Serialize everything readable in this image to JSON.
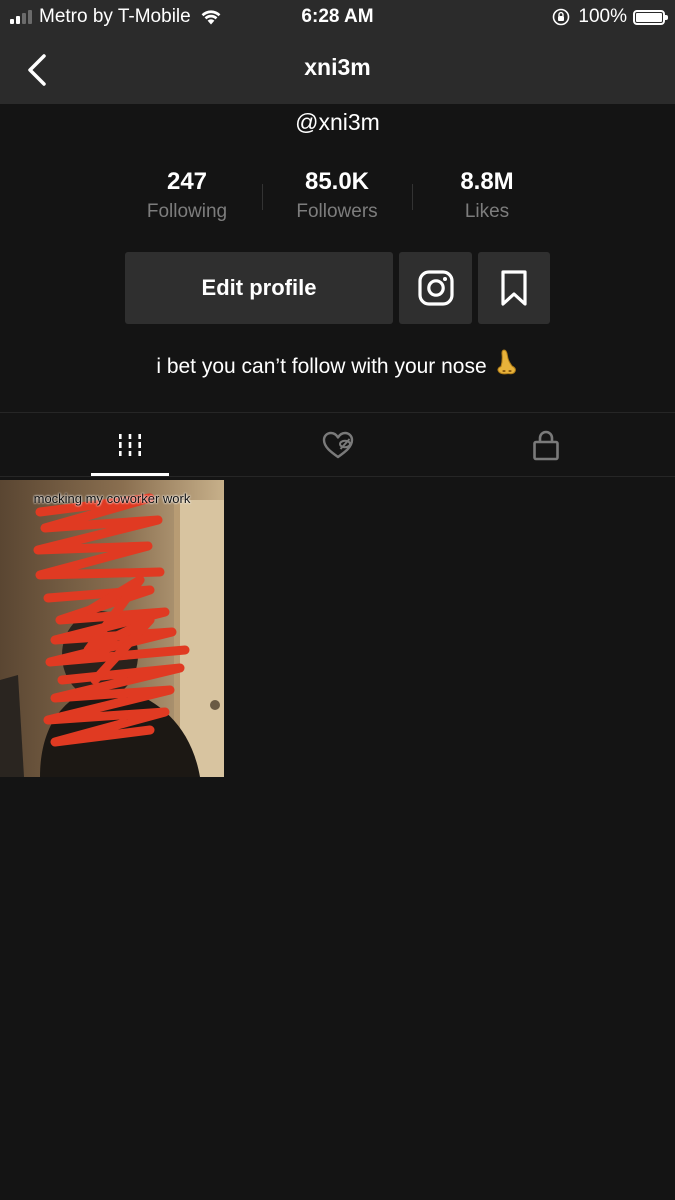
{
  "status_bar": {
    "carrier": "Metro by T-Mobile",
    "time": "6:28 AM",
    "battery": "100%"
  },
  "nav": {
    "title": "xni3m"
  },
  "profile": {
    "handle": "@xni3m",
    "stats": [
      {
        "value": "247",
        "label": "Following"
      },
      {
        "value": "85.0K",
        "label": "Followers"
      },
      {
        "value": "8.8M",
        "label": "Likes"
      }
    ],
    "edit_profile_label": "Edit profile",
    "bio": "i bet you can’t follow with your nose",
    "bio_emoji": "👃"
  },
  "tabs": [
    {
      "icon": "grid-videos-icon",
      "active": true
    },
    {
      "icon": "liked-videos-icon",
      "active": false
    },
    {
      "icon": "lock-icon",
      "active": false
    }
  ],
  "videos": [
    {
      "caption": "mocking my coworker work"
    }
  ],
  "colors": {
    "header_bg": "#2b2b2b",
    "page_bg": "#141414",
    "button_bg": "#2f2f2f",
    "muted_text": "#7d7d7d",
    "scribble": "#e03a22"
  }
}
